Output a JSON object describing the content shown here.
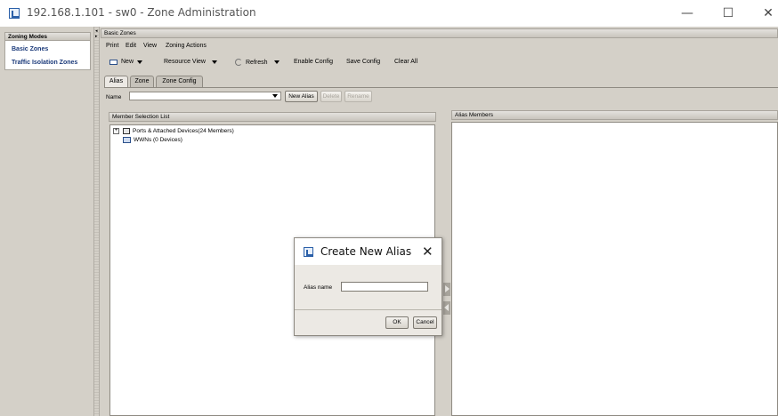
{
  "window": {
    "title": "192.168.1.101 - sw0 - Zone Administration",
    "minimize": "—",
    "maximize": "☐",
    "close": "✕"
  },
  "left_panel": {
    "header": "Zoning Modes",
    "items": [
      {
        "label": "Basic Zones",
        "selected": true
      },
      {
        "label": "Traffic Isolation Zones",
        "selected": false
      }
    ]
  },
  "right_panel": {
    "title": "Basic Zones",
    "menu": [
      "Print",
      "Edit",
      "View",
      "Zoning Actions"
    ],
    "toolbar": {
      "new": "New",
      "resource_view": "Resource View",
      "refresh": "Refresh",
      "enable_config": "Enable Config",
      "save_config": "Save Config",
      "clear_all": "Clear All"
    },
    "tabs": [
      {
        "label": "Alias",
        "active": true
      },
      {
        "label": "Zone",
        "active": false
      },
      {
        "label": "Zone Config",
        "active": false
      }
    ],
    "name_label": "Name",
    "name_value": "",
    "buttons": {
      "new_alias": "New Alias",
      "delete": "Delete",
      "rename": "Rename"
    },
    "member_selection": {
      "header": "Member Selection List",
      "tree": [
        {
          "label": "Ports & Attached Devices(24 Members)",
          "icon": "device-icon",
          "expandable": true
        },
        {
          "label": "WWNs (0 Devices)",
          "icon": "wwn-icon",
          "expandable": false
        }
      ]
    },
    "alias_members": {
      "header": "Alias Members"
    }
  },
  "dialog": {
    "title": "Create New Alias",
    "close": "✕",
    "field_label": "Alias name",
    "field_value": "",
    "ok": "OK",
    "cancel": "Cancel"
  },
  "colors": {
    "panel_bg": "#d4d0c8",
    "link_blue": "#1b3a7a",
    "dialog_body": "#ece9e4"
  }
}
